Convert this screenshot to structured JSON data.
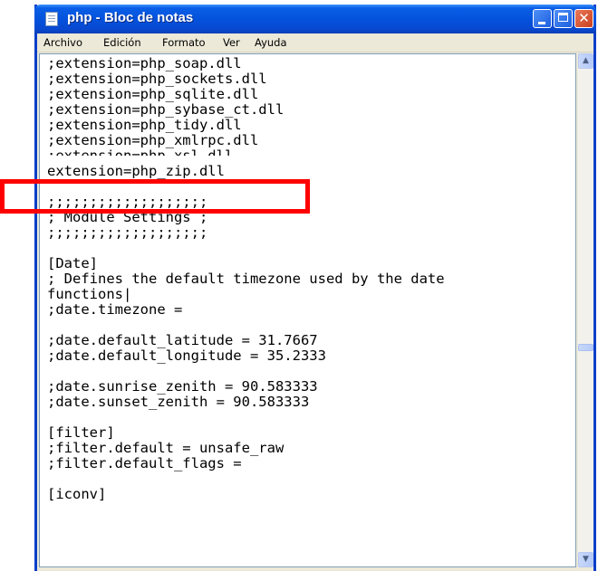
{
  "window": {
    "title": "php - Bloc de notas"
  },
  "menu": [
    "Archivo",
    "Edición",
    "Formato",
    "Ver",
    "Ayuda"
  ],
  "editor": {
    "lines": [
      ";extension=php_soap.dll",
      ";extension=php_sockets.dll",
      ";extension=php_sqlite.dll",
      ";extension=php_sybase_ct.dll",
      ";extension=php_tidy.dll",
      ";extension=php_xmlrpc.dll",
      ";extension=php_xsl.dll",
      "extension=php_zip.dll",
      ";;;;;;;;;;;;;;;;;;;",
      "; Module Settings ;",
      ";;;;;;;;;;;;;;;;;;;",
      "[Date]",
      "; Defines the default timezone used by the date",
      "functions|",
      ";date.timezone =",
      ";date.default_latitude = 31.7667",
      ";date.default_longitude = 35.2333",
      ";date.sunrise_zenith = 90.583333",
      ";date.sunset_zenith = 90.583333",
      "[filter]",
      ";filter.default = unsafe_raw",
      ";filter.default_flags =",
      "[iconv]"
    ]
  },
  "highlight_color": "#ff0000",
  "icons": {
    "app": "notepad-icon",
    "minimize": "minimize-icon",
    "maximize": "maximize-icon",
    "close": "close-icon",
    "scroll_up": "scroll-up-arrow-icon",
    "scroll_down": "scroll-down-arrow-icon"
  }
}
